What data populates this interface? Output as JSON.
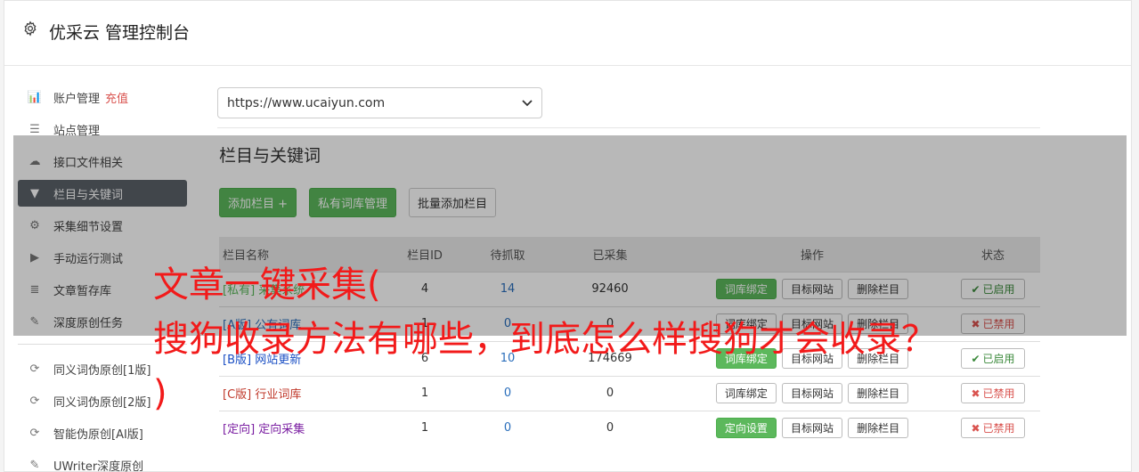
{
  "app": {
    "title": "优采云 管理控制台",
    "icon": "gear-icon"
  },
  "sidebar": {
    "items": [
      {
        "label": "账户管理",
        "extra": "充值",
        "icon": "bar-chart-icon",
        "glyph": "📊"
      },
      {
        "label": "站点管理",
        "icon": "server-icon",
        "glyph": "☰"
      },
      {
        "label": "接口文件相关",
        "icon": "cloud-upload-icon",
        "glyph": "☁"
      },
      {
        "label": "栏目与关键词",
        "icon": "filter-icon",
        "glyph": "▼",
        "active": true
      },
      {
        "label": "采集细节设置",
        "icon": "cogs-icon",
        "glyph": "⚙"
      },
      {
        "label": "手动运行测试",
        "icon": "play-circle-icon",
        "glyph": "▶"
      },
      {
        "label": "文章暂存库",
        "icon": "database-icon",
        "glyph": "≣"
      },
      {
        "label": "深度原创任务",
        "icon": "edit-icon",
        "glyph": "✎"
      }
    ],
    "items2": [
      {
        "label": "同义词伪原创[1版]",
        "icon": "refresh-icon",
        "glyph": "⟳"
      },
      {
        "label": "同义词伪原创[2版]",
        "icon": "refresh-icon",
        "glyph": "⟳"
      },
      {
        "label": "智能伪原创[AI版]",
        "icon": "refresh-icon",
        "glyph": "⟳"
      },
      {
        "label": "UWriter深度原创",
        "icon": "edit-icon",
        "glyph": "✎"
      }
    ]
  },
  "main": {
    "site_select": "https://www.ucaiyun.com",
    "section_title": "栏目与关键词",
    "buttons": {
      "add": "添加栏目 +",
      "private_lib": "私有词库管理",
      "batch_add": "批量添加栏目"
    },
    "table": {
      "headers": [
        "栏目名称",
        "栏目ID",
        "待抓取",
        "已采集",
        "操作",
        "状态"
      ],
      "rows": [
        {
          "tag": "[私有]",
          "name": "采集系统",
          "tag_class": "tag-sy",
          "id": "4",
          "pending": "14",
          "collected": "92460",
          "op1": "词库绑定",
          "op1_green": true,
          "op2": "目标网站",
          "op3": "删除栏目",
          "status": "已启用",
          "on": true
        },
        {
          "tag": "[A版]",
          "name": "公有词库",
          "tag_class": "tag-a",
          "id": "1",
          "pending": "0",
          "collected": "0",
          "op1": "词库绑定",
          "op1_green": false,
          "op2": "目标网站",
          "op3": "删除栏目",
          "status": "已禁用",
          "on": false
        },
        {
          "tag": "[B版]",
          "name": "网站更新",
          "tag_class": "tag-b",
          "id": "6",
          "pending": "10",
          "collected": "174669",
          "op1": "词库绑定",
          "op1_green": true,
          "op2": "目标网站",
          "op3": "删除栏目",
          "status": "已启用",
          "on": true
        },
        {
          "tag": "[C版]",
          "name": "行业词库",
          "tag_class": "tag-c",
          "id": "1",
          "pending": "0",
          "collected": "0",
          "op1": "词库绑定",
          "op1_green": false,
          "op2": "目标网站",
          "op3": "删除栏目",
          "status": "已禁用",
          "on": false
        },
        {
          "tag": "[定向]",
          "name": "定向采集",
          "tag_class": "tag-d",
          "id": "1",
          "pending": "0",
          "collected": "0",
          "op1": "定向设置",
          "op1_green": true,
          "op2": "目标网站",
          "op3": "删除栏目",
          "status": "已禁用",
          "on": false
        }
      ]
    }
  },
  "overlay": {
    "headline_line1": "文章一键采集(",
    "headline_line2": "搜狗收录方法有哪些，到底怎么样搜狗才会收录？",
    "headline_line3": ")",
    "color": "#f21a1a"
  },
  "colors": {
    "accent_green": "#5cb85c",
    "active_nav": "#5a6168",
    "danger": "#d9534f"
  }
}
